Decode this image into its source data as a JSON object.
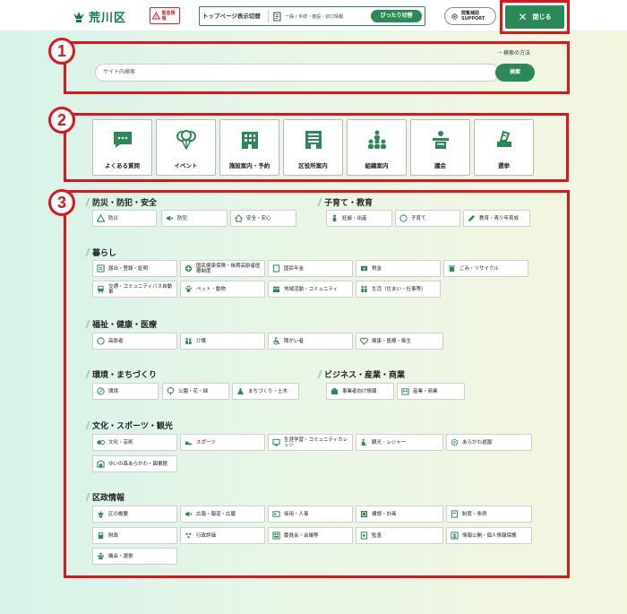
{
  "header": {
    "logo_text": "荒川区",
    "emergency": "緊急情報",
    "top_switch_label": "トップページ表示切替",
    "top_switch_options": "一般 / 手続・施設・窓口情報",
    "switch_button": "ぴったり切替",
    "support_line1": "閲覧補助",
    "support_line2": "SUPPORT",
    "close_label": "閉じる"
  },
  "search": {
    "method_link": "検索の方法",
    "placeholder": "サイト内検索",
    "button": "検索"
  },
  "markers": [
    "1",
    "2",
    "3"
  ],
  "quick_links": [
    {
      "label": "よくある質問",
      "icon": "chat-icon"
    },
    {
      "label": "イベント",
      "icon": "balloons-icon"
    },
    {
      "label": "施設案内・予約",
      "icon": "building-icon"
    },
    {
      "label": "区役所案内",
      "icon": "city-hall-icon"
    },
    {
      "label": "組織案内",
      "icon": "org-chart-icon"
    },
    {
      "label": "議会",
      "icon": "podium-icon"
    },
    {
      "label": "選挙",
      "icon": "ballot-icon"
    }
  ],
  "categories": {
    "bousai": {
      "title": "防災・防犯・安全",
      "items": [
        "防災",
        "防犯",
        "安全・安心"
      ]
    },
    "kosodate": {
      "title": "子育て・教育",
      "items": [
        "妊娠・出産",
        "子育て",
        "教育・青少年育成"
      ]
    },
    "kurashi": {
      "title": "暮らし",
      "items": [
        "届出・登録・証明",
        "国民健康保険・後期高齢者医療制度",
        "国民年金",
        "税金",
        "ごみ・リサイクル",
        "交通・コミュニティバス自動車",
        "ペット・動物",
        "地域活動・コミュニティ",
        "生活（住まい・仕事等）"
      ]
    },
    "fukushi": {
      "title": "福祉・健康・医療",
      "items": [
        "高齢者",
        "介護",
        "障がい者",
        "健康・医療・衛生"
      ]
    },
    "kankyo": {
      "title": "環境・まちづくり",
      "items": [
        "環境",
        "公園・花・緑",
        "まちづくり・土木"
      ]
    },
    "business": {
      "title": "ビジネス・産業・商業",
      "items": [
        "事業者向け情報",
        "産業・商業"
      ]
    },
    "bunka": {
      "title": "文化・スポーツ・観光",
      "items": [
        "文化・芸術",
        "スポーツ",
        "生涯学習・コミュニティカレッジ",
        "観光・レジャー",
        "あらかわ遊園",
        "ゆいの森あらかわ・図書館"
      ]
    },
    "gyosei": {
      "title": "区政情報",
      "items": [
        "区の概要",
        "広報・報道・広聴",
        "採用・人事",
        "構想・計画",
        "制度・条例",
        "財政",
        "行政評価",
        "委員会・会議等",
        "監査",
        "情報公開・個人情報保護",
        "議会・選挙"
      ]
    }
  },
  "colors": {
    "accent": "#2a8a57",
    "highlight": "#e0151b"
  }
}
